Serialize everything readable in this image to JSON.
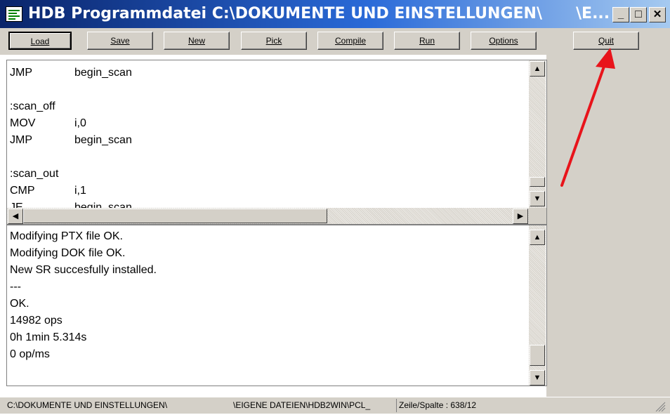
{
  "window": {
    "title": "HDB Programmdatei C:\\DOKUMENTE UND EINSTELLUNGEN\\",
    "title_tail": "\\E...",
    "minimize": "_",
    "maximize": "□",
    "close": "✕"
  },
  "toolbar": {
    "buttons": [
      {
        "label": "Load"
      },
      {
        "label": "Save"
      },
      {
        "label": "New"
      },
      {
        "label": "Pick"
      },
      {
        "label": "Compile"
      },
      {
        "label": "Run"
      },
      {
        "label": "Options"
      },
      {
        "label": "Quit"
      }
    ]
  },
  "editor": {
    "lines": [
      {
        "op": "JMP",
        "arg": "begin_scan"
      },
      {
        "op": "",
        "arg": ""
      },
      {
        "op": ":scan_off",
        "arg": ""
      },
      {
        "op": "MOV",
        "arg": "i,0"
      },
      {
        "op": "JMP",
        "arg": "begin_scan"
      },
      {
        "op": "",
        "arg": ""
      },
      {
        "op": ":scan_out",
        "arg": ""
      },
      {
        "op": "CMP",
        "arg": "i,1"
      },
      {
        "op": "JE",
        "arg": "begin_scan"
      }
    ]
  },
  "output": {
    "lines": [
      "Modifying PTX file OK.",
      "Modifying DOK file OK.",
      "New SR succesfully installed.",
      "---",
      "OK.",
      "14982 ops",
      "0h 1min 5.314s",
      "0 op/ms"
    ]
  },
  "statusbar": {
    "path_left": "C:\\DOKUMENTE UND EINSTELLUNGEN\\",
    "path_right": "\\EIGENE DATEIEN\\HDB2WIN\\PCL_",
    "position": "Zeile/Spalte : 638/12"
  },
  "annotation": {
    "arrow_color": "#e8141b"
  }
}
